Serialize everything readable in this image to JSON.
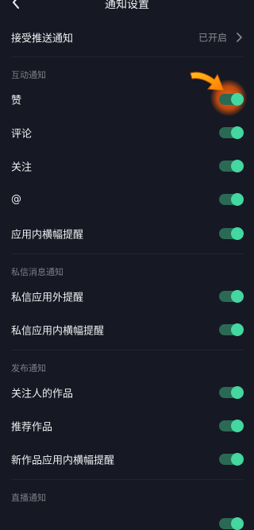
{
  "header": {
    "title": "通知设置"
  },
  "push": {
    "label": "接受推送通知",
    "value": "已开启"
  },
  "sections": {
    "interaction": {
      "title": "互动通知",
      "items": [
        "赞",
        "评论",
        "关注",
        "@",
        "应用内横幅提醒"
      ]
    },
    "message": {
      "title": "私信消息通知",
      "items": [
        "私信应用外提醒",
        "私信应用内横幅提醒"
      ]
    },
    "publish": {
      "title": "发布通知",
      "items": [
        "关注人的作品",
        "推荐作品",
        "新作品应用内横幅提醒"
      ]
    },
    "live": {
      "title": "直播通知"
    }
  },
  "toggle_state": "on",
  "colors": {
    "bg": "#161823",
    "toggle_on": "#44d7a0",
    "highlight": "#ff6a14"
  }
}
